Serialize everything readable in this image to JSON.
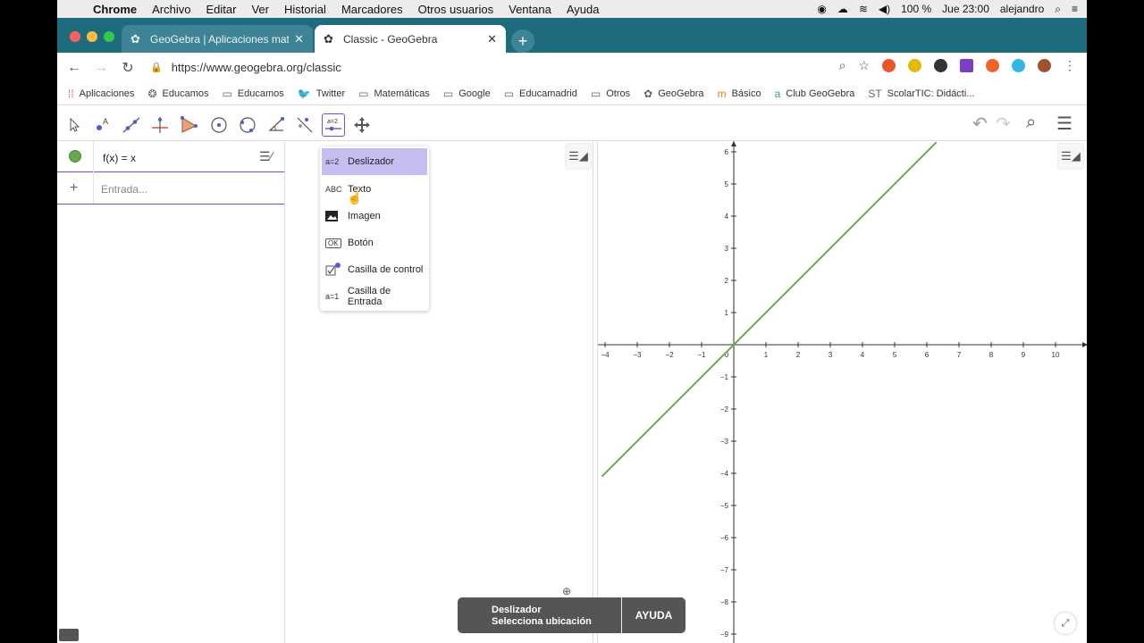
{
  "menubar": {
    "app": "Chrome",
    "items": [
      "Archivo",
      "Editar",
      "Ver",
      "Historial",
      "Marcadores",
      "Otros usuarios",
      "Ventana",
      "Ayuda"
    ],
    "battery": "100 %",
    "clock": "Jue 23:00",
    "user": "alejandro"
  },
  "tabs": [
    {
      "title": "GeoGebra | Aplicaciones mate",
      "active": false
    },
    {
      "title": "Classic - GeoGebra",
      "active": true
    }
  ],
  "address": {
    "url": "https://www.geogebra.org/classic"
  },
  "bookmarks": [
    {
      "label": "Aplicaciones",
      "icon": "apps-grid-icon"
    },
    {
      "label": "Educamos",
      "icon": "educamos-icon"
    },
    {
      "label": "Educamos",
      "icon": "folder-icon"
    },
    {
      "label": "Twitter",
      "icon": "twitter-icon"
    },
    {
      "label": "Matemáticas",
      "icon": "folder-icon"
    },
    {
      "label": "Google",
      "icon": "folder-icon"
    },
    {
      "label": "Educamadrid",
      "icon": "folder-icon"
    },
    {
      "label": "Otros",
      "icon": "folder-icon"
    },
    {
      "label": "GeoGebra",
      "icon": "geogebra-icon"
    },
    {
      "label": "Básico",
      "icon": "basico-icon"
    },
    {
      "label": "Club GeoGebra",
      "icon": "club-icon"
    },
    {
      "label": "ScolarTIC: Didácti...",
      "icon": "scolartic-icon"
    }
  ],
  "algebra": {
    "expression": "f(x) = x",
    "input_placeholder": "Entrada..."
  },
  "dropdown": {
    "items": [
      {
        "label": "Deslizador",
        "icon_text": "a=2",
        "selected": true
      },
      {
        "label": "Texto",
        "icon_text": "ABC",
        "selected": false
      },
      {
        "label": "Imagen",
        "icon_text": "",
        "selected": false
      },
      {
        "label": "Botón",
        "icon_text": "OK",
        "selected": false
      },
      {
        "label": "Casilla de control",
        "icon_text": "",
        "selected": false
      },
      {
        "label": "Casilla de Entrada",
        "icon_text": "a=1",
        "selected": false
      }
    ]
  },
  "toast": {
    "title": "Deslizador",
    "subtitle": "Selecciona ubicación",
    "help": "AYUDA"
  },
  "graph": {
    "x_ticks": [
      "−4",
      "−3",
      "−2",
      "−1",
      "0",
      "1",
      "2",
      "3",
      "4",
      "5",
      "6",
      "7",
      "8",
      "9",
      "10"
    ],
    "y_ticks": [
      "6",
      "5",
      "4",
      "3",
      "2",
      "1",
      "−1",
      "−2",
      "−3",
      "−4",
      "−5",
      "−6",
      "−7",
      "−8",
      "−9"
    ],
    "function_color": "#6aa84f"
  },
  "chart_data": {
    "type": "line",
    "series": [
      {
        "name": "f(x) = x",
        "x": [
          -4.1,
          6.3
        ],
        "y": [
          -4.1,
          6.3
        ]
      }
    ],
    "xlim": [
      -4.2,
      11
    ],
    "ylim": [
      -9,
      6.3
    ],
    "grid": false
  }
}
